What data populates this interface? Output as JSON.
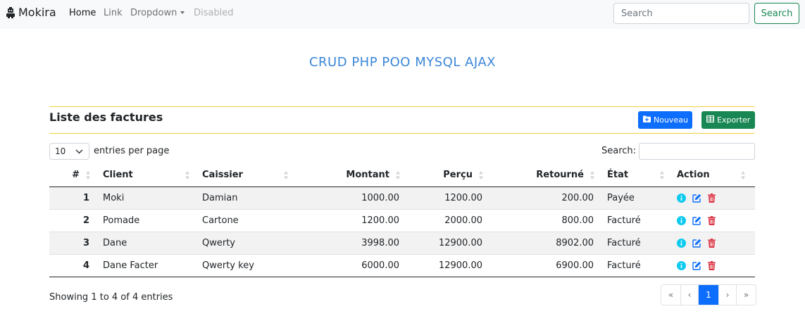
{
  "navbar": {
    "brand": "Mokira",
    "links": [
      "Home",
      "Link",
      "Dropdown",
      "Disabled"
    ],
    "search_placeholder": "Search",
    "search_button": "Search"
  },
  "heading": "CRUD PHP POO MYSQL AJAX",
  "list": {
    "title": "Liste des factures",
    "new_button": "Nouveau",
    "export_button": "Exporter"
  },
  "controls": {
    "page_length": "10",
    "length_label": "entries per page",
    "search_label": "Search:"
  },
  "table": {
    "headers": [
      "#",
      "Client",
      "Caissier",
      "Montant",
      "Perçu",
      "Retourné",
      "État",
      "Action"
    ],
    "rows": [
      {
        "id": "1",
        "client": "Moki",
        "caissier": "Damian",
        "montant": "1000.00",
        "percu": "1200.00",
        "retourne": "200.00",
        "etat": "Payée"
      },
      {
        "id": "2",
        "client": "Pomade",
        "caissier": "Cartone",
        "montant": "1200.00",
        "percu": "2000.00",
        "retourne": "800.00",
        "etat": "Facturé"
      },
      {
        "id": "3",
        "client": "Dane",
        "caissier": "Qwerty",
        "montant": "3998.00",
        "percu": "12900.00",
        "retourne": "8902.00",
        "etat": "Facturé"
      },
      {
        "id": "4",
        "client": "Dane Facter",
        "caissier": "Qwerty key",
        "montant": "6000.00",
        "percu": "12900.00",
        "retourne": "6900.00",
        "etat": "Facturé"
      }
    ]
  },
  "footer": {
    "info": "Showing 1 to 4 of 4 entries",
    "pagination": [
      "«",
      "‹",
      "1",
      "›",
      "»"
    ]
  },
  "colors": {
    "primary": "#0d6efd",
    "success": "#198754",
    "info_icon": "#0dcaf0",
    "danger": "#dc3545",
    "heading": "#3b86d9",
    "rule": "#f1d03a"
  },
  "icons": [
    "robot-icon",
    "folder-plus-icon",
    "table-icon",
    "chevron-down-icon",
    "sort-icon",
    "info-icon",
    "edit-icon",
    "trash-icon"
  ]
}
